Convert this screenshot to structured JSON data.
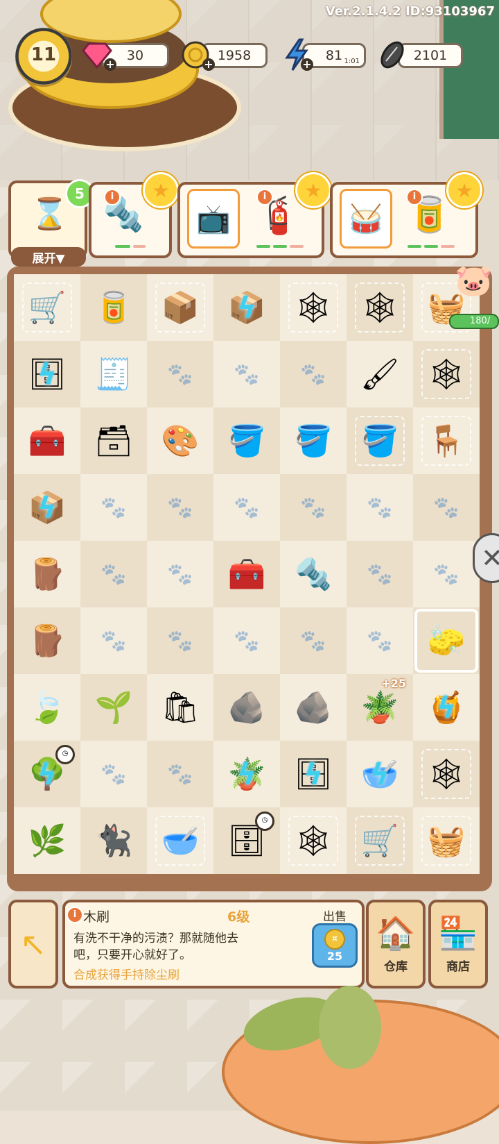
{
  "version": "Ver.2.1.4.2 ID:93103967",
  "level": "11",
  "resources": {
    "gems": "30",
    "coins": "1958",
    "energy": "81",
    "energy_timer": "1:01",
    "seeds": "2101"
  },
  "orders": {
    "hourglass_count": "5",
    "expand_label": "展开▼"
  },
  "piggy_bank": "180/",
  "board": {
    "rows": [
      [
        "cart-web",
        "can",
        "box-web",
        "box-bolt",
        "web",
        "web",
        "sack-web"
      ],
      [
        "shelf-bolt",
        "tray",
        "",
        "",
        "",
        "brushes",
        "web"
      ],
      [
        "toolbox",
        "drawer",
        "tubes",
        "bucket",
        "bucket-handle",
        "bucket-web",
        "table-web"
      ],
      [
        "box-bolt",
        "",
        "",
        "",
        "",
        "",
        ""
      ],
      [
        "plank",
        "",
        "",
        "toolbox-yellow",
        "screw",
        "",
        ""
      ],
      [
        "logs",
        "",
        "",
        "",
        "",
        "",
        "brush-selected"
      ],
      [
        "leaves",
        "sapling",
        "bag",
        "shard",
        "shard2",
        "plant-pot-bonus",
        "pot-bolt"
      ],
      [
        "tree-bolt",
        "",
        "",
        "plant-pot-bolt",
        "shelf-bolt2",
        "bowl-bolt",
        "web-pile"
      ],
      [
        "seedling",
        "black-cat",
        "web-bowl",
        "cabinet-clock",
        "web-small",
        "cart-web2",
        "sack-web2"
      ]
    ],
    "bonus_label": "+25"
  },
  "panel": {
    "item_name": "木刷",
    "item_level": "6级",
    "description": "有洗不干净的污渍？那就随他去吧，只要开心就好了。",
    "hint": "合成获得手持除尘刷",
    "sell_label": "出售",
    "sell_price": "25",
    "warehouse_label": "仓库",
    "shop_label": "商店"
  }
}
